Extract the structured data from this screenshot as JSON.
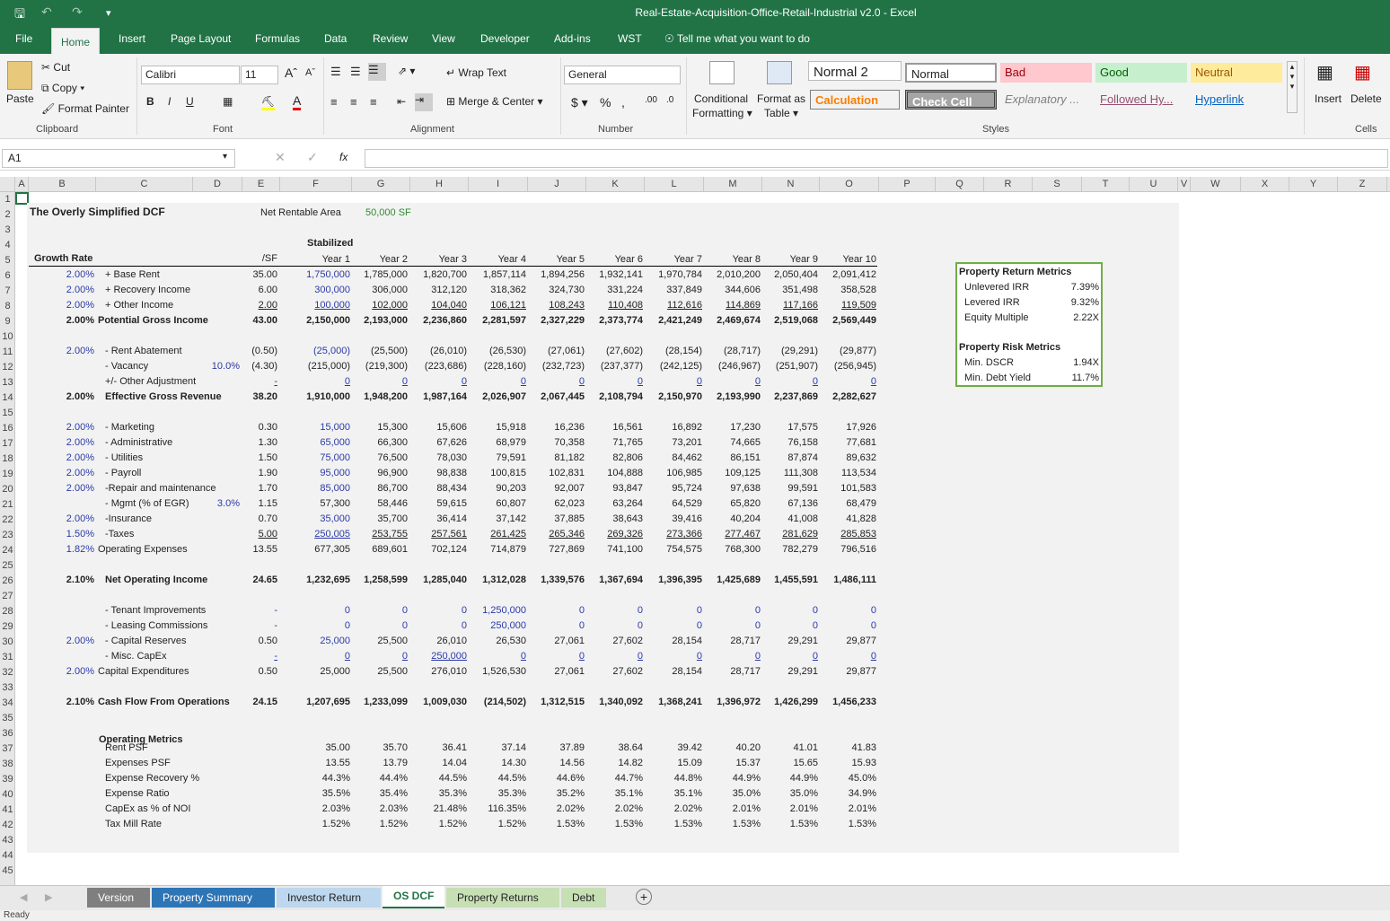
{
  "window": {
    "title": "Real-Estate-Acquisition-Office-Retail-Industrial v2.0  -  Excel"
  },
  "ribbon_tabs": [
    "File",
    "Home",
    "Insert",
    "Page Layout",
    "Formulas",
    "Data",
    "Review",
    "View",
    "Developer",
    "Add-ins",
    "WST"
  ],
  "tell_me": "Tell me what you want to do",
  "clipboard": {
    "paste": "Paste",
    "cut": "Cut",
    "copy": "Copy",
    "format_painter": "Format Painter",
    "label": "Clipboard"
  },
  "font": {
    "name": "Calibri",
    "size": "11",
    "label": "Font"
  },
  "alignment": {
    "wrap": "Wrap Text",
    "merge": "Merge & Center",
    "label": "Alignment"
  },
  "number": {
    "format": "General",
    "label": "Number"
  },
  "styles": {
    "cond": "Conditional",
    "cond2": "Formatting",
    "fmt_table": "Format as",
    "fmt_table2": "Table",
    "items": [
      "Normal 2",
      "Normal",
      "Bad",
      "Good",
      "Neutral",
      "Calculation",
      "Check Cell",
      "Explanatory ...",
      "Followed Hy...",
      "Hyperlink"
    ],
    "label": "Styles"
  },
  "cells": {
    "insert": "Insert",
    "delete": "Delete",
    "label": "Cells"
  },
  "name_box": "A1",
  "formula_fx": "fx",
  "columns": [
    "A",
    "B",
    "C",
    "D",
    "E",
    "F",
    "G",
    "H",
    "I",
    "J",
    "K",
    "L",
    "M",
    "N",
    "O",
    "P",
    "Q",
    "R",
    "S",
    "T",
    "U",
    "V",
    "W",
    "X",
    "Y",
    "Z"
  ],
  "rows": [
    "1",
    "2",
    "3",
    "4",
    "5",
    "6",
    "7",
    "8",
    "9",
    "10",
    "11",
    "12",
    "13",
    "14",
    "15",
    "16",
    "17",
    "18",
    "19",
    "20",
    "21",
    "22",
    "23",
    "24",
    "25",
    "26",
    "27",
    "28",
    "29",
    "30",
    "31",
    "32",
    "33",
    "34",
    "35",
    "36",
    "37",
    "38",
    "39",
    "40",
    "41",
    "42",
    "43",
    "44",
    "45"
  ],
  "sheet": {
    "title": "The Overly Simplified DCF",
    "nra_label": "Net Rentable Area",
    "nra_value": "50,000 SF",
    "stabilized": "Stabilized",
    "growth_header": "Growth Rate",
    "psf_header": "/SF",
    "years": [
      "Year 1",
      "Year 2",
      "Year 3",
      "Year 4",
      "Year 5",
      "Year 6",
      "Year 7",
      "Year 8",
      "Year 9",
      "Year 10"
    ],
    "lines": [
      {
        "row": 6,
        "g": "2.00%",
        "label": "+ Base Rent",
        "psf": "35.00",
        "v": [
          "1,750,000",
          "1,785,000",
          "1,820,700",
          "1,857,114",
          "1,894,256",
          "1,932,141",
          "1,970,784",
          "2,010,200",
          "2,050,404",
          "2,091,412"
        ],
        "y1blue": true
      },
      {
        "row": 7,
        "g": "2.00%",
        "label": "+ Recovery Income",
        "psf": "6.00",
        "v": [
          "300,000",
          "306,000",
          "312,120",
          "318,362",
          "324,730",
          "331,224",
          "337,849",
          "344,606",
          "351,498",
          "358,528"
        ],
        "y1blue": true
      },
      {
        "row": 8,
        "g": "2.00%",
        "label": "+ Other Income",
        "psf": "2.00",
        "v": [
          "100,000",
          "102,000",
          "104,040",
          "106,121",
          "108,243",
          "110,408",
          "112,616",
          "114,869",
          "117,166",
          "119,509"
        ],
        "y1blue": true,
        "ul": true
      },
      {
        "row": 9,
        "g": "2.00%",
        "label": "Potential Gross Income",
        "psf": "43.00",
        "v": [
          "2,150,000",
          "2,193,000",
          "2,236,860",
          "2,281,597",
          "2,327,229",
          "2,373,774",
          "2,421,249",
          "2,469,674",
          "2,519,068",
          "2,569,449"
        ],
        "bold": true,
        "shift": true
      },
      {
        "row": 11,
        "g": "2.00%",
        "label": "- Rent Abatement",
        "psf": "(0.50)",
        "v": [
          "(25,000)",
          "(25,500)",
          "(26,010)",
          "(26,530)",
          "(27,061)",
          "(27,602)",
          "(28,154)",
          "(28,717)",
          "(29,291)",
          "(29,877)"
        ],
        "y1blue": true
      },
      {
        "row": 12,
        "g": "",
        "label": "- Vacancy",
        "extra": "10.0%",
        "psf": "(4.30)",
        "v": [
          "(215,000)",
          "(219,300)",
          "(223,686)",
          "(228,160)",
          "(232,723)",
          "(237,377)",
          "(242,125)",
          "(246,967)",
          "(251,907)",
          "(256,945)"
        ]
      },
      {
        "row": 13,
        "g": "",
        "label": "+/- Other Adjustment",
        "psf": "-",
        "v": [
          "0",
          "0",
          "0",
          "0",
          "0",
          "0",
          "0",
          "0",
          "0",
          "0"
        ],
        "allblue": true,
        "ul": true
      },
      {
        "row": 14,
        "g": "2.00%",
        "label": "Effective Gross Revenue",
        "psf": "38.20",
        "v": [
          "1,910,000",
          "1,948,200",
          "1,987,164",
          "2,026,907",
          "2,067,445",
          "2,108,794",
          "2,150,970",
          "2,193,990",
          "2,237,869",
          "2,282,627"
        ],
        "bold": true
      },
      {
        "row": 16,
        "g": "2.00%",
        "label": "- Marketing",
        "psf": "0.30",
        "v": [
          "15,000",
          "15,300",
          "15,606",
          "15,918",
          "16,236",
          "16,561",
          "16,892",
          "17,230",
          "17,575",
          "17,926"
        ],
        "y1blue": true
      },
      {
        "row": 17,
        "g": "2.00%",
        "label": "- Administrative",
        "psf": "1.30",
        "v": [
          "65,000",
          "66,300",
          "67,626",
          "68,979",
          "70,358",
          "71,765",
          "73,201",
          "74,665",
          "76,158",
          "77,681"
        ],
        "y1blue": true
      },
      {
        "row": 18,
        "g": "2.00%",
        "label": "- Utilities",
        "psf": "1.50",
        "v": [
          "75,000",
          "76,500",
          "78,030",
          "79,591",
          "81,182",
          "82,806",
          "84,462",
          "86,151",
          "87,874",
          "89,632"
        ],
        "y1blue": true
      },
      {
        "row": 19,
        "g": "2.00%",
        "label": "- Payroll",
        "psf": "1.90",
        "v": [
          "95,000",
          "96,900",
          "98,838",
          "100,815",
          "102,831",
          "104,888",
          "106,985",
          "109,125",
          "111,308",
          "113,534"
        ],
        "y1blue": true
      },
      {
        "row": 20,
        "g": "2.00%",
        "label": "-Repair and maintenance",
        "psf": "1.70",
        "v": [
          "85,000",
          "86,700",
          "88,434",
          "90,203",
          "92,007",
          "93,847",
          "95,724",
          "97,638",
          "99,591",
          "101,583"
        ],
        "y1blue": true
      },
      {
        "row": 21,
        "g": "",
        "label": "- Mgmt (% of EGR)",
        "extra": "3.0%",
        "psf": "1.15",
        "v": [
          "57,300",
          "58,446",
          "59,615",
          "60,807",
          "62,023",
          "63,264",
          "64,529",
          "65,820",
          "67,136",
          "68,479"
        ]
      },
      {
        "row": 22,
        "g": "2.00%",
        "label": "-Insurance",
        "psf": "0.70",
        "v": [
          "35,000",
          "35,700",
          "36,414",
          "37,142",
          "37,885",
          "38,643",
          "39,416",
          "40,204",
          "41,008",
          "41,828"
        ],
        "y1blue": true
      },
      {
        "row": 23,
        "g": "1.50%",
        "label": "-Taxes",
        "psf": "5.00",
        "v": [
          "250,005",
          "253,755",
          "257,561",
          "261,425",
          "265,346",
          "269,326",
          "273,366",
          "277,467",
          "281,629",
          "285,853"
        ],
        "y1blue": true,
        "ul": true
      },
      {
        "row": 24,
        "g": "1.82%",
        "label": "Operating Expenses",
        "psf": "13.55",
        "v": [
          "677,305",
          "689,601",
          "702,124",
          "714,879",
          "727,869",
          "741,100",
          "754,575",
          "768,300",
          "782,279",
          "796,516"
        ],
        "shift": true
      },
      {
        "row": 26,
        "g": "2.10%",
        "label": "Net Operating Income",
        "psf": "24.65",
        "v": [
          "1,232,695",
          "1,258,599",
          "1,285,040",
          "1,312,028",
          "1,339,576",
          "1,367,694",
          "1,396,395",
          "1,425,689",
          "1,455,591",
          "1,486,111"
        ],
        "bold": true
      },
      {
        "row": 28,
        "g": "",
        "label": "- Tenant Improvements",
        "psf": "-",
        "v": [
          "0",
          "0",
          "0",
          "1,250,000",
          "0",
          "0",
          "0",
          "0",
          "0",
          "0"
        ],
        "allblue": true
      },
      {
        "row": 29,
        "g": "",
        "label": "- Leasing Commissions",
        "psf": "-",
        "v": [
          "0",
          "0",
          "0",
          "250,000",
          "0",
          "0",
          "0",
          "0",
          "0",
          "0"
        ],
        "allblue": true
      },
      {
        "row": 30,
        "g": "2.00%",
        "label": "- Capital Reserves",
        "psf": "0.50",
        "v": [
          "25,000",
          "25,500",
          "26,010",
          "26,530",
          "27,061",
          "27,602",
          "28,154",
          "28,717",
          "29,291",
          "29,877"
        ],
        "y1blue": true
      },
      {
        "row": 31,
        "g": "",
        "label": "- Misc. CapEx",
        "psf": "-",
        "v": [
          "0",
          "0",
          "250,000",
          "0",
          "0",
          "0",
          "0",
          "0",
          "0",
          "0"
        ],
        "allblue": true,
        "ul": true
      },
      {
        "row": 32,
        "g": "2.00%",
        "label": "Capital Expenditures",
        "psf": "0.50",
        "v": [
          "25,000",
          "25,500",
          "276,010",
          "1,526,530",
          "27,061",
          "27,602",
          "28,154",
          "28,717",
          "29,291",
          "29,877"
        ],
        "shift": true
      },
      {
        "row": 34,
        "g": "2.10%",
        "label": "Cash Flow From Operations",
        "psf": "24.15",
        "v": [
          "1,207,695",
          "1,233,099",
          "1,009,030",
          "(214,502)",
          "1,312,515",
          "1,340,092",
          "1,368,241",
          "1,396,972",
          "1,426,299",
          "1,456,233"
        ],
        "bold": true,
        "shift": true
      }
    ],
    "op_metrics_title": "Operating Metrics",
    "op_metrics": [
      {
        "row": 37,
        "label": "Rent PSF",
        "v": [
          "35.00",
          "35.70",
          "36.41",
          "37.14",
          "37.89",
          "38.64",
          "39.42",
          "40.20",
          "41.01",
          "41.83"
        ]
      },
      {
        "row": 38,
        "label": "Expenses PSF",
        "v": [
          "13.55",
          "13.79",
          "14.04",
          "14.30",
          "14.56",
          "14.82",
          "15.09",
          "15.37",
          "15.65",
          "15.93"
        ]
      },
      {
        "row": 39,
        "label": "Expense Recovery %",
        "v": [
          "44.3%",
          "44.4%",
          "44.5%",
          "44.5%",
          "44.6%",
          "44.7%",
          "44.8%",
          "44.9%",
          "44.9%",
          "45.0%"
        ]
      },
      {
        "row": 40,
        "label": "Expense Ratio",
        "v": [
          "35.5%",
          "35.4%",
          "35.3%",
          "35.3%",
          "35.2%",
          "35.1%",
          "35.1%",
          "35.0%",
          "35.0%",
          "34.9%"
        ]
      },
      {
        "row": 41,
        "label": "CapEx as % of NOI",
        "v": [
          "2.03%",
          "2.03%",
          "21.48%",
          "116.35%",
          "2.02%",
          "2.02%",
          "2.02%",
          "2.01%",
          "2.01%",
          "2.01%"
        ]
      },
      {
        "row": 42,
        "label": "Tax Mill Rate",
        "v": [
          "1.52%",
          "1.52%",
          "1.52%",
          "1.52%",
          "1.53%",
          "1.53%",
          "1.53%",
          "1.53%",
          "1.53%",
          "1.53%"
        ]
      }
    ]
  },
  "metrics": {
    "return_title": "Property Return Metrics",
    "returns": [
      {
        "label": "Unlevered IRR",
        "value": "7.39%"
      },
      {
        "label": "Levered IRR",
        "value": "9.32%"
      },
      {
        "label": "Equity Multiple",
        "value": "2.22X"
      }
    ],
    "risk_title": "Property Risk Metrics",
    "risks": [
      {
        "label": "Min. DSCR",
        "value": "1.94X"
      },
      {
        "label": "Min. Debt Yield",
        "value": "11.7%"
      }
    ]
  },
  "sheet_tabs": [
    {
      "label": "Version",
      "color": "#7f7f7f",
      "text": "#ffffff"
    },
    {
      "label": "Property Summary",
      "color": "#2e75b6",
      "text": "#ffffff"
    },
    {
      "label": "Investor Return",
      "color": "#bdd7ee",
      "text": "#222222"
    },
    {
      "label": "OS DCF",
      "color": "#ffffff",
      "text": "#217346",
      "active": true
    },
    {
      "label": "Property Returns",
      "color": "#c6e0b4",
      "text": "#222222"
    },
    {
      "label": "Debt",
      "color": "#c6e0b4",
      "text": "#222222"
    }
  ],
  "status": "Ready",
  "colors": {
    "excel_green": "#217346",
    "input_blue": "#2b3aa8",
    "green_text": "#2e8b2e",
    "metric_border": "#70ad47"
  }
}
